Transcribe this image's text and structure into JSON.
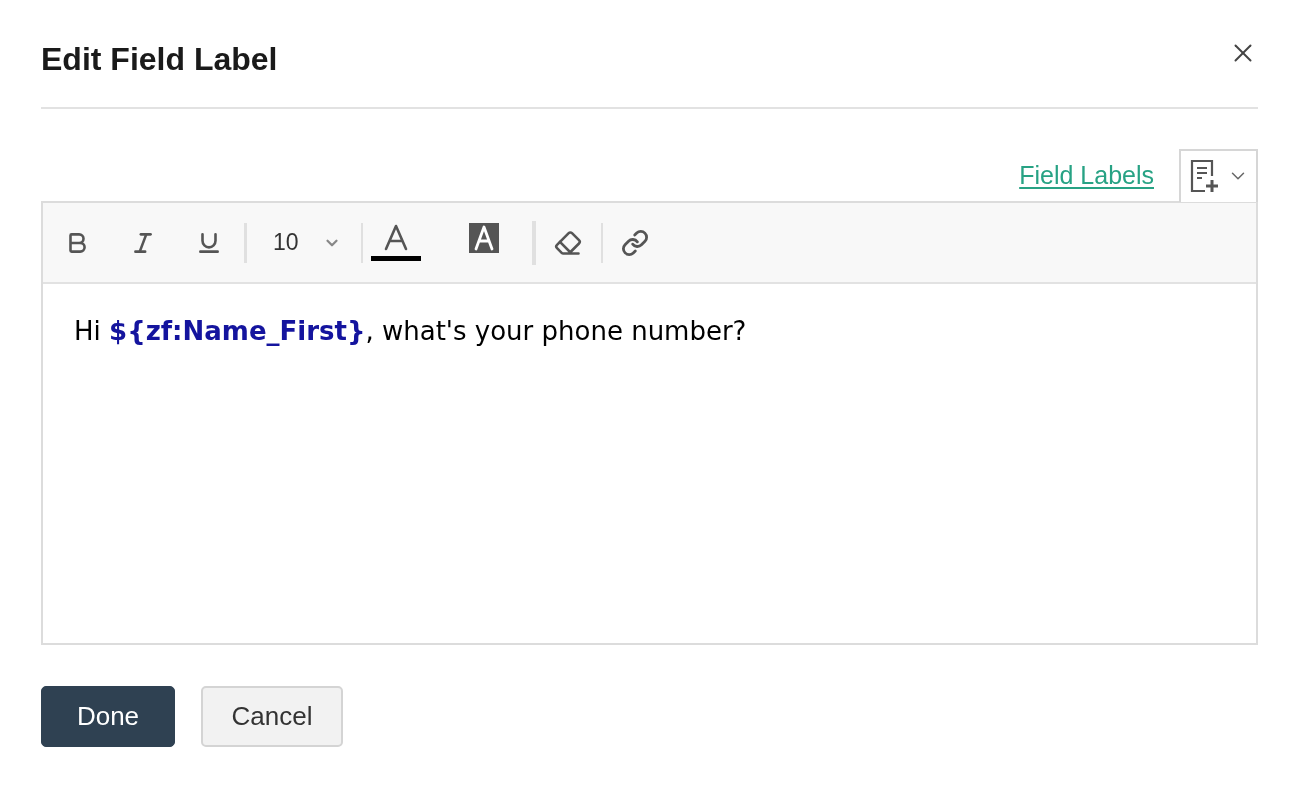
{
  "dialog": {
    "title": "Edit Field Label"
  },
  "insert_bar": {
    "link": "Field Labels"
  },
  "toolbar": {
    "font_size": "10"
  },
  "editor": {
    "content": "Hi **${zf:Name_First}**, what's your phone number?"
  },
  "buttons": [
    {
      "label": "Done",
      "kind": "primary"
    },
    {
      "label": "Cancel",
      "kind": "secondary"
    }
  ]
}
